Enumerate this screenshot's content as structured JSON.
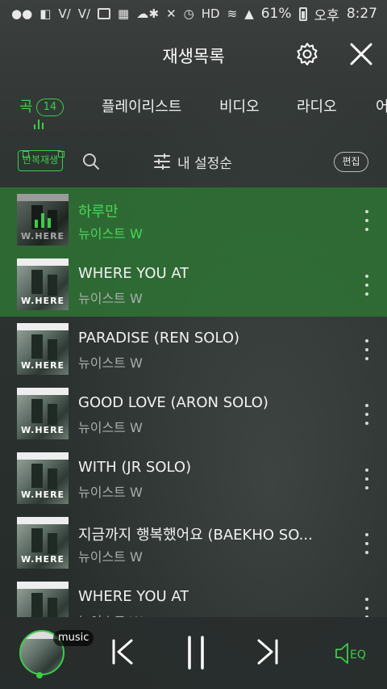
{
  "status_bar": {
    "battery": "61%",
    "ampm": "오후",
    "time": "8:27"
  },
  "header": {
    "title": "재생목록"
  },
  "tabs": [
    {
      "label": "곡",
      "badge": "14",
      "active": true
    },
    {
      "label": "플레이리스트"
    },
    {
      "label": "비디오"
    },
    {
      "label": "라디오"
    },
    {
      "label": "어"
    }
  ],
  "toolbar": {
    "repeat_label": "반복재생",
    "sort_label": "내 설정순",
    "edit_label": "편집"
  },
  "album_art_text": "W.HERE",
  "songs": [
    {
      "title": "하루만",
      "artist": "뉴이스트 W",
      "playing": true,
      "selected": true
    },
    {
      "title": "WHERE YOU AT",
      "artist": "뉴이스트 W",
      "selected": true
    },
    {
      "title": "PARADISE (REN SOLO)",
      "artist": "뉴이스트 W"
    },
    {
      "title": "GOOD LOVE (ARON SOLO)",
      "artist": "뉴이스트 W"
    },
    {
      "title": "WITH (JR SOLO)",
      "artist": "뉴이스트 W"
    },
    {
      "title": "지금까지 행복했어요 (BAEKHO SO...",
      "artist": "뉴이스트 W"
    },
    {
      "title": "WHERE YOU AT",
      "artist": "뉴이스트 W"
    }
  ],
  "player": {
    "badge": "music",
    "eq_label": "EQ"
  },
  "colors": {
    "accent": "#3ccc4a",
    "selected_row": "#2e7834"
  }
}
